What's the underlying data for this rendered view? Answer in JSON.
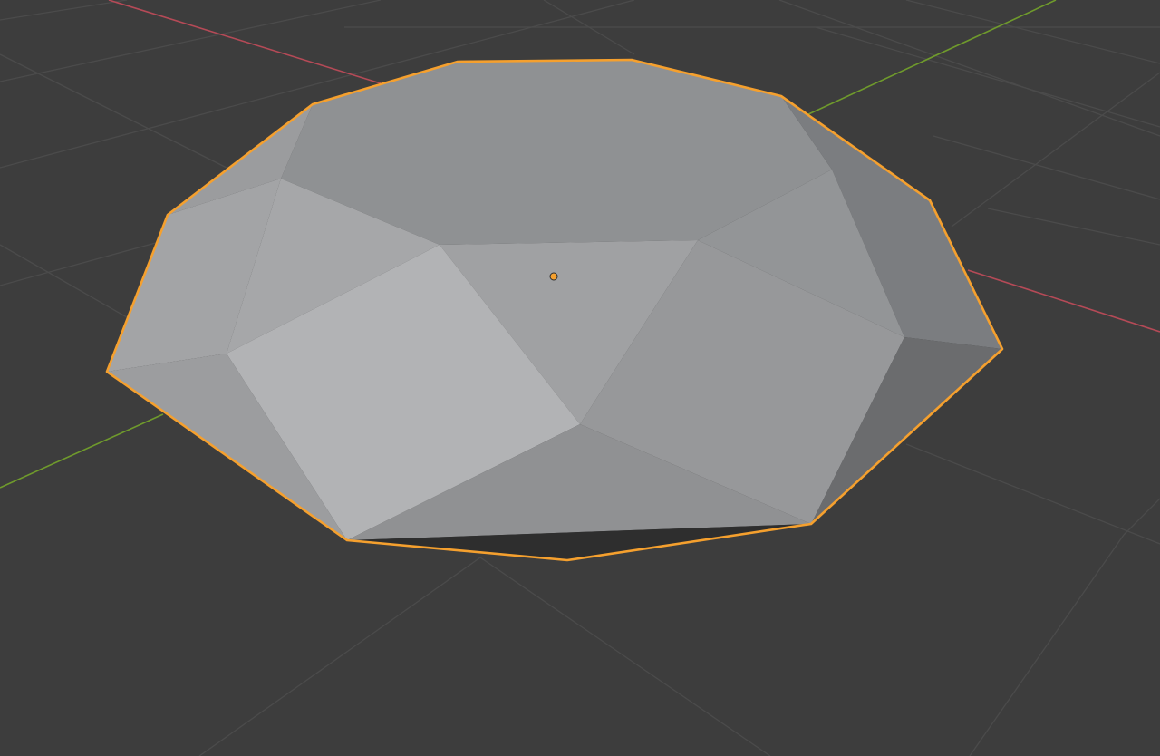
{
  "viewport": {
    "background": "#3d3d3d",
    "grid_color": "#4a4a4a",
    "x_axis_color": "#b54a57",
    "y_axis_color": "#6f9a2c",
    "selection_outline_color": "#f5a02e",
    "origin_marker_color": "#f5a02e",
    "object": {
      "name_icon": "mesh-object-icon",
      "selected": true,
      "shading": "solid"
    }
  }
}
